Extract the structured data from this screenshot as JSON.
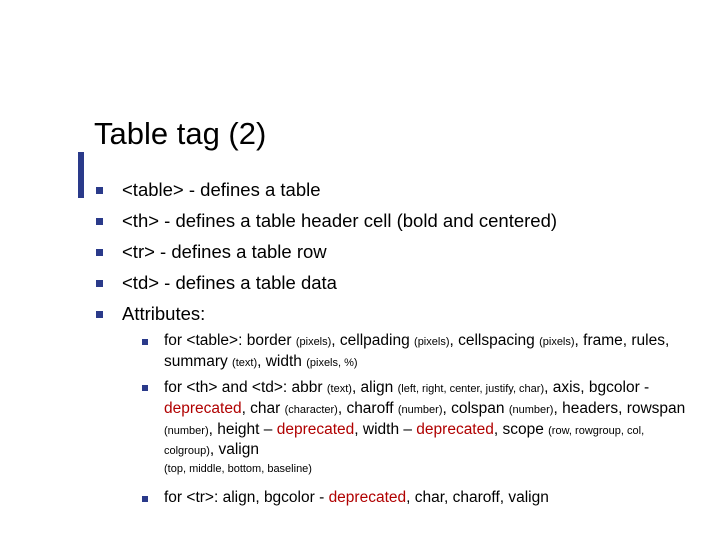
{
  "title": "Table tag (2)",
  "bullets": {
    "b1": "<table> - defines a table",
    "b2": "<th> - defines a table header cell (bold and centered)",
    "b3": "<tr> - defines a table row",
    "b4": "<td> - defines a table data",
    "b5": "Attributes:"
  },
  "attr": {
    "table": {
      "lead": "for <table>: border ",
      "p1": "(pixels)",
      "s1": ", cellpading ",
      "p2": "(pixels)",
      "s2": ", cellspacing  ",
      "p3": "(pixels)",
      "s3": ", frame, rules, summary ",
      "p4": "(text)",
      "s4": ", width ",
      "p5": "(pixels, %)"
    },
    "thtd": {
      "lead": "for <th> and <td>: abbr ",
      "p1": "(text)",
      "s1": ", align ",
      "p2": "(left, right, center, justify, char)",
      "s2": ", axis, bgcolor - ",
      "dep1": "deprecated",
      "s3": ", char ",
      "p3": "(character)",
      "s4": ", charoff ",
      "p4": "(number)",
      "s5": ", colspan ",
      "p5": "(number)",
      "s6": ", headers, rowspan ",
      "p6": "(number)",
      "s7": ", height – ",
      "dep2": "deprecated",
      "s8": ", width – ",
      "dep3": "deprecated",
      "s9": ", scope ",
      "p7": "(row, rowgroup, col, colgroup)",
      "s10": ", valign ",
      "p8": "(top, middle, bottom, baseline)"
    },
    "tr": {
      "lead": "for <tr>: align, bgcolor - ",
      "dep": "deprecated",
      "tail": ", char, charoff, valign"
    }
  }
}
